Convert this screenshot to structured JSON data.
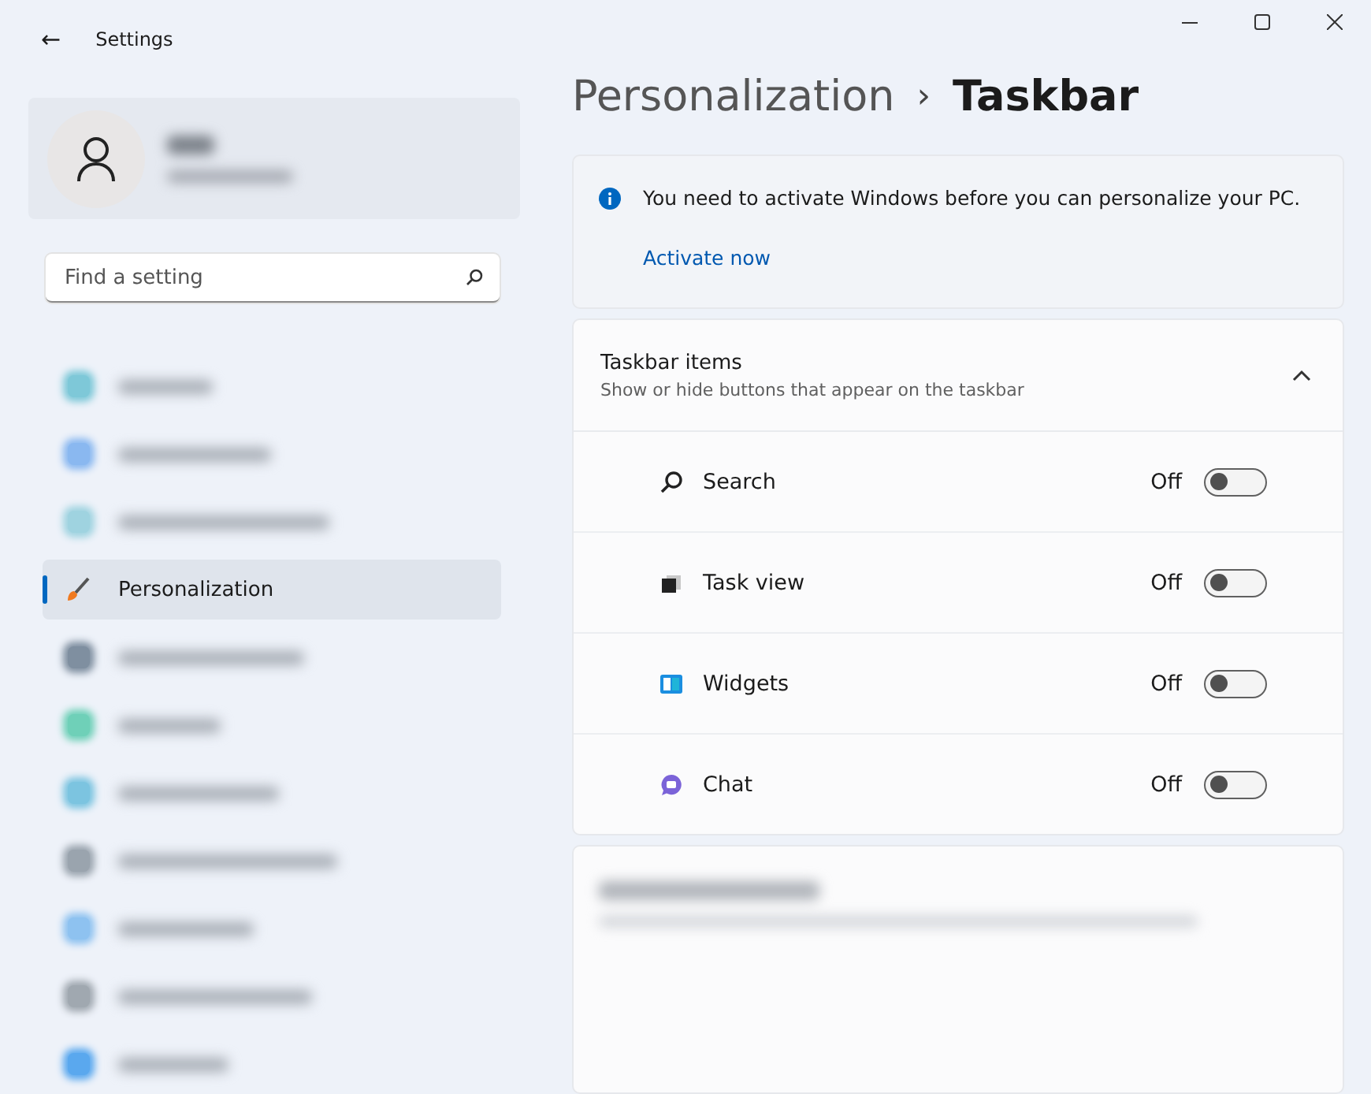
{
  "window": {
    "title": "Settings",
    "back": "←"
  },
  "search": {
    "placeholder": "Find a setting"
  },
  "sidebar": {
    "items": [
      {
        "kind": "blurred",
        "color": "#7ec8d8",
        "selected": false
      },
      {
        "kind": "blurred",
        "color": "#8ab8f0",
        "selected": false
      },
      {
        "kind": "blurred",
        "color": "#9fd3e0",
        "selected": false
      },
      {
        "kind": "text",
        "label": "Personalization",
        "selected": true
      },
      {
        "kind": "blurred",
        "color": "#7f8fa0",
        "selected": false
      },
      {
        "kind": "blurred",
        "color": "#6fd0b8",
        "selected": false
      },
      {
        "kind": "blurred",
        "color": "#7cc4e0",
        "selected": false
      },
      {
        "kind": "blurred",
        "color": "#9aa4ae",
        "selected": false
      },
      {
        "kind": "blurred",
        "color": "#8ec2f0",
        "selected": false
      },
      {
        "kind": "blurred",
        "color": "#a0a8b0",
        "selected": false
      },
      {
        "kind": "blurred",
        "color": "#5aa8ee",
        "selected": false
      }
    ]
  },
  "breadcrumb": {
    "parent": "Personalization",
    "separator": "›",
    "current": "Taskbar"
  },
  "notice": {
    "message": "You need to activate Windows before you can personalize your PC.",
    "link": "Activate now"
  },
  "taskbar_items": {
    "title": "Taskbar items",
    "subtitle": "Show or hide buttons that appear on the taskbar",
    "expanded": true,
    "rows": [
      {
        "kind": "search",
        "label": "Search",
        "reading": "Off",
        "on": false
      },
      {
        "kind": "task-view",
        "label": "Task view",
        "reading": "Off",
        "on": false
      },
      {
        "kind": "widgets",
        "label": "Widgets",
        "reading": "Off",
        "on": false
      },
      {
        "kind": "chat",
        "label": "Chat",
        "reading": "Off",
        "on": false
      }
    ]
  }
}
